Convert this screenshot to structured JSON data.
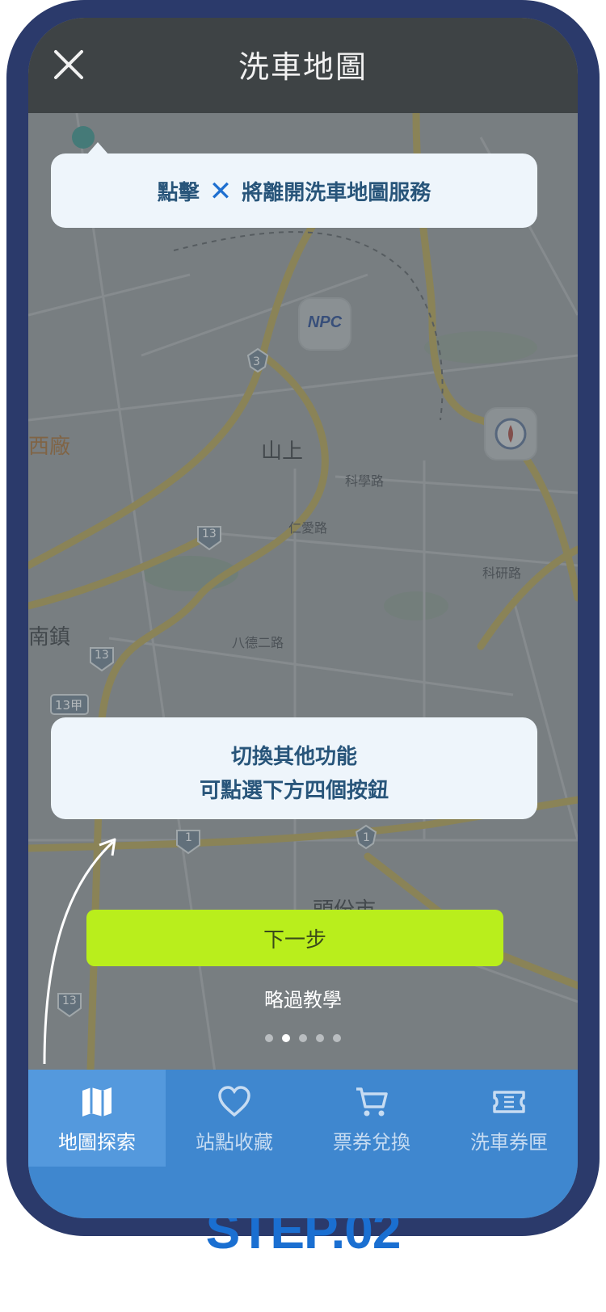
{
  "header": {
    "title": "洗車地圖"
  },
  "tooltips": {
    "top": {
      "before": "點擊",
      "after": "將離開洗車地圖服務"
    },
    "bottom": {
      "line1": "切換其他功能",
      "line2": "可點選下方四個按鈕"
    }
  },
  "map_labels": {
    "shanshang": "山上",
    "toufen": "頭份市",
    "nan_zhen": "南鎮",
    "xi_chang": "西廠",
    "kexue_rd": "科學路",
    "renai_rd": "仁愛路",
    "keyan_rd": "科研路",
    "bade_rd2": "八德二路",
    "route_3": "3",
    "route_13": "13",
    "route_13_b": "13",
    "route_13jia": "13甲",
    "route_1": "1",
    "route_1_b": "1",
    "route_13_c": "13",
    "npc": "NPC"
  },
  "actions": {
    "next": "下一步",
    "skip": "略過教學"
  },
  "pagination": {
    "total": 5,
    "current": 2
  },
  "tabs": [
    {
      "label": "地圖探索",
      "icon": "map-icon",
      "active": true
    },
    {
      "label": "站點收藏",
      "icon": "heart-icon",
      "active": false
    },
    {
      "label": "票券兌換",
      "icon": "cart-icon",
      "active": false
    },
    {
      "label": "洗車券匣",
      "icon": "ticket-icon",
      "active": false
    }
  ],
  "step": "STEP.02",
  "colors": {
    "frame": "#2b3a6b",
    "header": "#3e4345",
    "tooltip_bg": "#eef5fb",
    "tooltip_text": "#28557a",
    "next_button": "#b9ee1c",
    "tabbar": "#3f87cf",
    "tab_active": "#5499dd",
    "step_text": "#1a6fd1"
  }
}
